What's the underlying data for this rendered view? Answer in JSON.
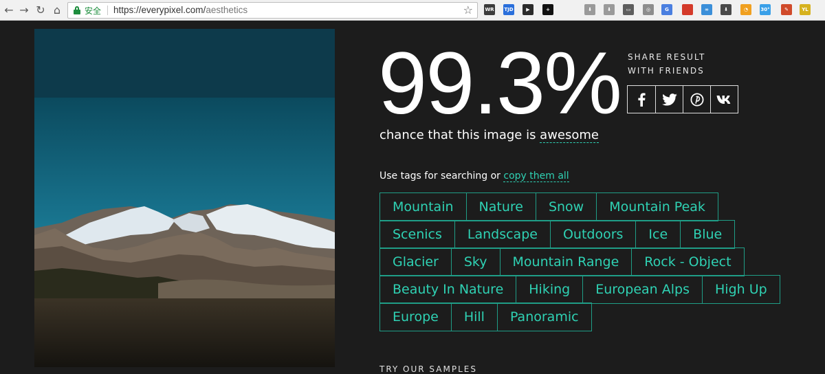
{
  "browser": {
    "url_domain": "https://everypixel.com/",
    "url_path": "aesthetics",
    "secure_label": "安全",
    "extensions": [
      {
        "name": "wr-extension-icon",
        "label": "WR",
        "color": "#3c3c3c"
      },
      {
        "name": "tjd-extension-icon",
        "label": "TJD",
        "color": "#2a6fdb"
      },
      {
        "name": "youtube-extension-icon",
        "label": "▶",
        "color": "#2b2b2b"
      },
      {
        "name": "plus-extension-icon",
        "label": "+",
        "color": "#111111"
      },
      {
        "name": "no-ads-extension-icon",
        "label": "",
        "color": "#f1f1f1"
      },
      {
        "name": "download-extension-icon",
        "label": "⬇",
        "color": "#9a9a9a"
      },
      {
        "name": "download2-extension-icon",
        "label": "⬇",
        "color": "#9a9a9a"
      },
      {
        "name": "screen-extension-icon",
        "label": "▭",
        "color": "#5e5e5e"
      },
      {
        "name": "swirl-extension-icon",
        "label": "◎",
        "color": "#8d8d8d"
      },
      {
        "name": "translate-extension-icon",
        "label": "G",
        "color": "#4a7fe0"
      },
      {
        "name": "bookmark-red-extension-icon",
        "label": "",
        "color": "#d43a2a"
      },
      {
        "name": "link-extension-icon",
        "label": "∞",
        "color": "#3b8fd9"
      },
      {
        "name": "save-extension-icon",
        "label": "⬇",
        "color": "#4a4a4a"
      },
      {
        "name": "ring-extension-icon",
        "label": "◔",
        "color": "#f0a020"
      },
      {
        "name": "weather-extension-icon",
        "label": "30°",
        "color": "#3aa0e8"
      },
      {
        "name": "tool-extension-icon",
        "label": "✎",
        "color": "#d04a2a"
      },
      {
        "name": "yellow-extension-icon",
        "label": "YL",
        "color": "#d6b21e"
      }
    ]
  },
  "result": {
    "score": "99.3%",
    "share_line1": "SHARE RESULT",
    "share_line2": "WITH FRIENDS",
    "share_buttons": [
      {
        "name": "share-facebook-button",
        "glyph": "f"
      },
      {
        "name": "share-twitter-button",
        "glyph": "t"
      },
      {
        "name": "share-pinterest-button",
        "glyph": "p"
      },
      {
        "name": "share-vk-button",
        "glyph": "vk"
      }
    ],
    "tagline_prefix": "chance that this image is ",
    "tagline_word": "awesome"
  },
  "tags_section": {
    "hint": "Use tags for searching or ",
    "copy_link": "copy them all",
    "rows": [
      [
        "Mountain",
        "Nature",
        "Snow",
        "Mountain Peak"
      ],
      [
        "Scenics",
        "Landscape",
        "Outdoors",
        "Ice",
        "Blue"
      ],
      [
        "Glacier",
        "Sky",
        "Mountain Range",
        "Rock - Object"
      ],
      [
        "Beauty In Nature",
        "Hiking",
        "European Alps",
        "High Up"
      ],
      [
        "Europe",
        "Hill",
        "Panoramic"
      ]
    ]
  },
  "samples_heading": "TRY OUR SAMPLES",
  "colors": {
    "background": "#1c1c1c",
    "accent": "#2fd2b4",
    "tag_border": "#1f9e87"
  }
}
